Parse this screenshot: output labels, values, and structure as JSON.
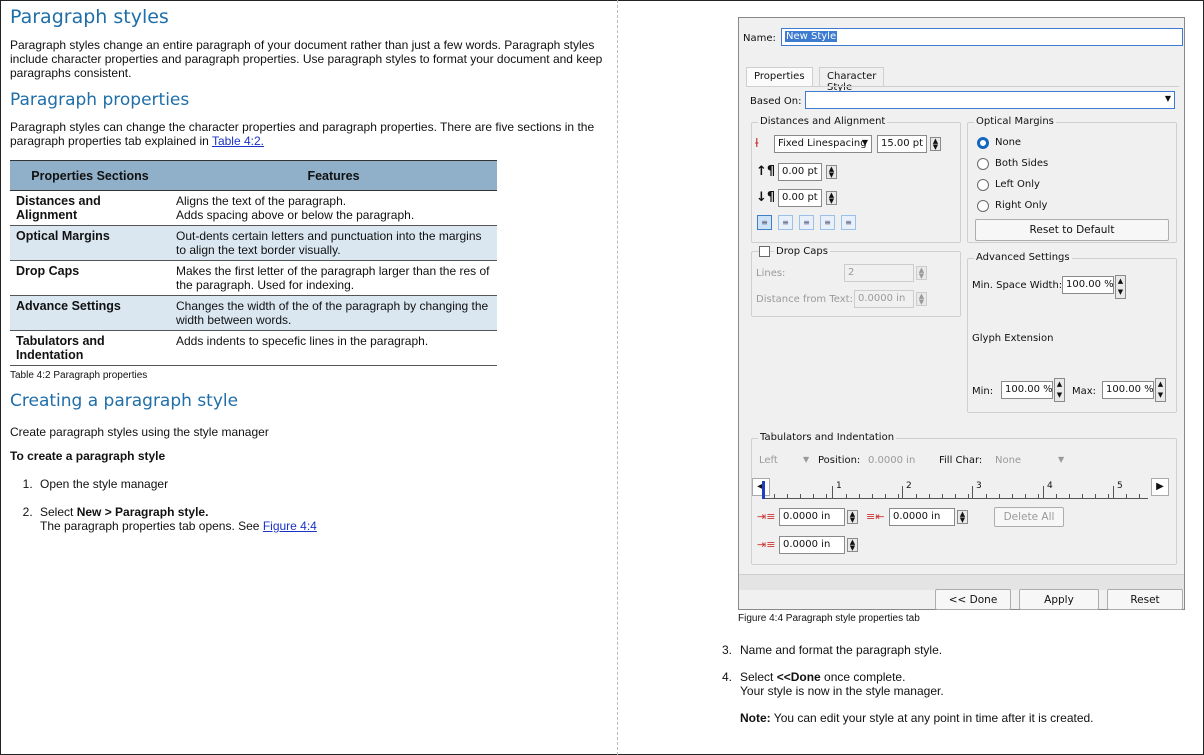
{
  "left_page": {
    "heading": "Paragraph styles",
    "intro": "Paragraph styles change an entire paragraph of your document rather than just a few words. Paragraph styles include character properties and paragraph properties. Use paragraph styles to format your document and keep paragraphs consistent.",
    "sub_heading": "Paragraph properties",
    "sub_text": "Paragraph styles can change the character properties and paragraph properties. There are five sections in the paragraph properties tab explained in",
    "sub_link": "Table 4:2.",
    "table": {
      "headers": [
        "Properties Sections",
        "Features"
      ],
      "rows": [
        {
          "section": "Distances and Alignment",
          "feature": "Aligns the text of the paragraph.\nAdds spacing above or below the paragraph."
        },
        {
          "section": "Optical Margins",
          "feature": "Out-dents certain letters and punctuation into the margins to align the text border visually."
        },
        {
          "section": "Drop Caps",
          "feature": "Makes the first letter of the paragraph larger than the res of the paragraph. Used for indexing."
        },
        {
          "section": "Advance Settings",
          "feature": "Changes the width of the of the paragraph by changing the width between words."
        },
        {
          "section": "Tabulators and Indentation",
          "feature": "Adds indents to specefic lines in the paragraph."
        }
      ],
      "caption": "Table 4:2  Paragraph properties"
    },
    "heading2": "Creating a paragraph style",
    "create_text": "Create paragraph styles using the style manager",
    "procedure_title": "To create a paragraph style",
    "step1": "Open the style manager",
    "step2_prefix": "Select ",
    "step2_bold": "New > Paragraph style.",
    "step2_detail": "The paragraph properties tab opens. See ",
    "step2_link": "Figure 4:4"
  },
  "dialog": {
    "name_label": "Name:",
    "name_value": "New Style",
    "tabs": [
      "Properties",
      "Character Style"
    ],
    "based_on_label": "Based On:",
    "distances_group": "Distances and Alignment",
    "linespacing_mode": "Fixed Linespacing",
    "linespacing_value": "15.00 pt",
    "space_above": "0.00 pt",
    "space_below": "0.00 pt",
    "optical_group": "Optical Margins",
    "optical_options": [
      "None",
      "Both Sides",
      "Left Only",
      "Right Only"
    ],
    "reset_default": "Reset to Default",
    "dropcaps_label": "Drop Caps",
    "lines_label": "Lines:",
    "lines_value": "2",
    "distance_label": "Distance from Text:",
    "distance_value": "0.0000 in",
    "advanced_group": "Advanced Settings",
    "min_space_label": "Min. Space Width:",
    "min_space_value": "100.00 %",
    "glyph_label": "Glyph Extension",
    "min_label": "Min:",
    "min_value": "100.00 %",
    "max_label": "Max:",
    "max_value": "100.00 %",
    "tabs_group": "Tabulators and Indentation",
    "tab_type": "Left",
    "position_label": "Position:",
    "position_value": "0.0000 in",
    "fill_label": "Fill Char:",
    "fill_value": "None",
    "ruler_numbers": [
      "1",
      "2",
      "3",
      "4",
      "5"
    ],
    "first_indent": "0.0000 in",
    "left_indent": "0.0000 in",
    "right_indent": "0.0000 in",
    "delete_all": "Delete All",
    "done": "<< Done",
    "apply": "Apply",
    "reset": "Reset"
  },
  "right_page": {
    "figure_caption": "Figure 4:4 Paragraph style properties tab",
    "step3_num": "3.",
    "step3": "Name and format the paragraph style.",
    "step4_num": "4.",
    "step4_prefix": "Select ",
    "step4_bold": "<<Done",
    "step4_suffix": " once complete.",
    "step4_detail": "Your style is now in the style manager.",
    "note_label": "Note:",
    "note_text": " You can edit your style at any point in time after it is created."
  }
}
